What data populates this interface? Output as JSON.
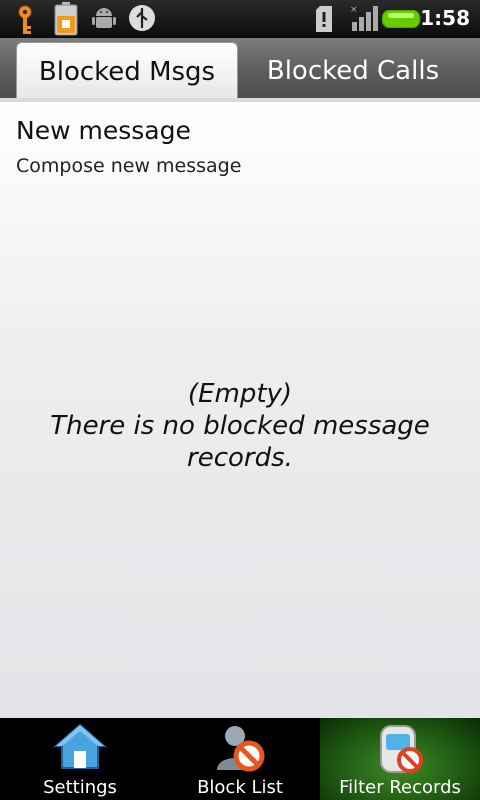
{
  "status_bar": {
    "time": "1:58",
    "icons": [
      "key-icon",
      "battery-lock-icon",
      "android-debug-icon",
      "usb-icon",
      "sd-card-warning-icon",
      "signal-icon",
      "battery-icon"
    ]
  },
  "tabs": [
    {
      "label": "Blocked Msgs",
      "active": true
    },
    {
      "label": "Blocked Calls",
      "active": false
    }
  ],
  "content": {
    "new_message_title": "New message",
    "new_message_subtitle": "Compose new message",
    "empty_title": "(Empty)",
    "empty_message": "There is no blocked message records."
  },
  "bottom_nav": [
    {
      "label": "Settings",
      "icon": "home-icon"
    },
    {
      "label": "Block List",
      "icon": "block-contact-icon"
    },
    {
      "label": "Filter Records",
      "icon": "filter-phone-icon",
      "selected": true
    }
  ],
  "colors": {
    "active_nav_green": "#3f8a25",
    "battery_green": "#66cc00"
  }
}
